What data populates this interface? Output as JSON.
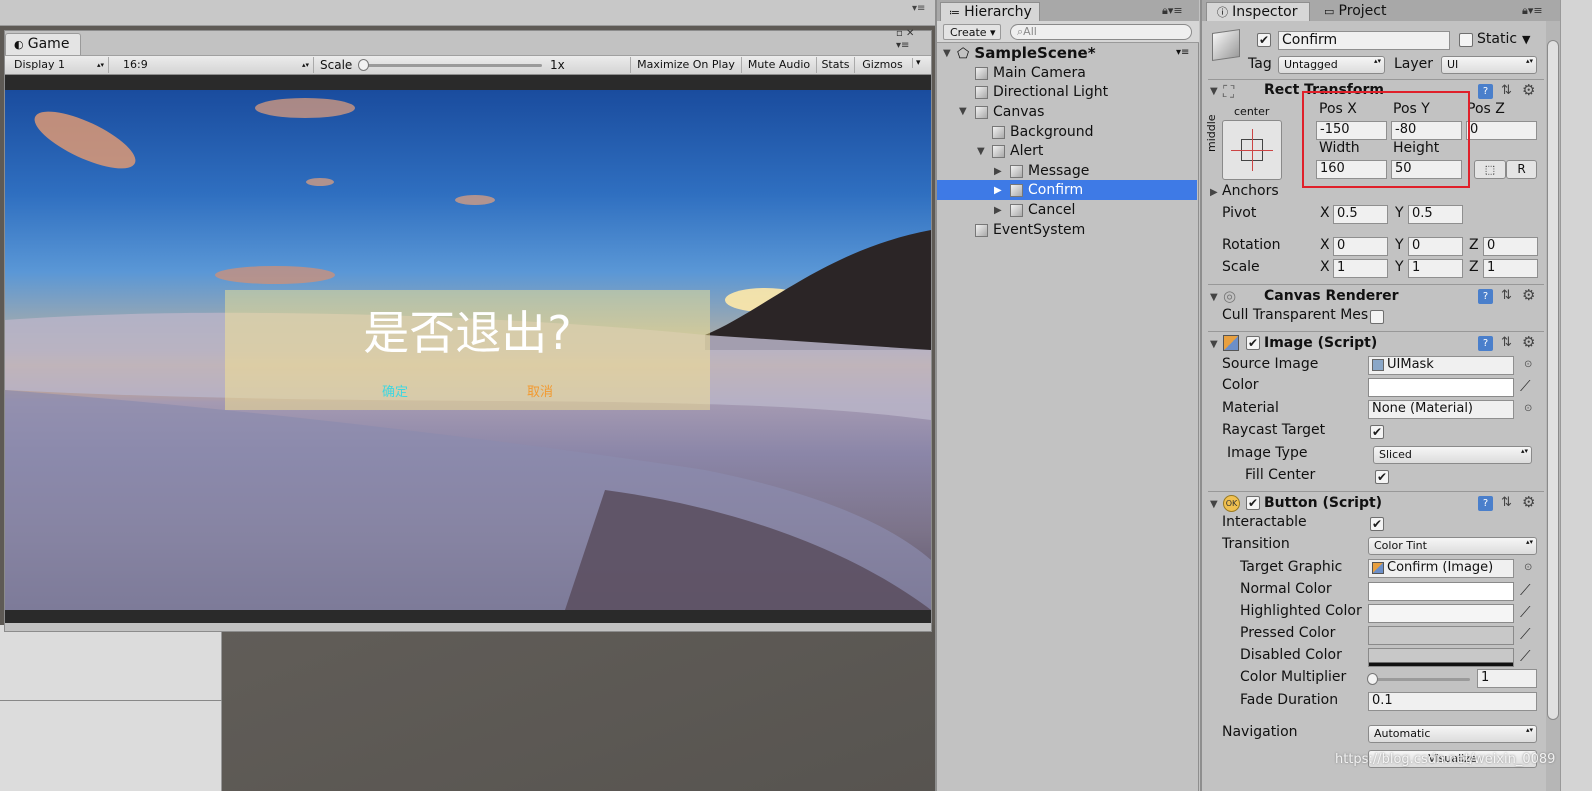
{
  "game": {
    "tab_label": "Game",
    "display": "Display 1",
    "aspect": "16:9",
    "scale_label": "Scale",
    "scale_value": "1x",
    "buttons": [
      "Maximize On Play",
      "Mute Audio",
      "Stats",
      "Gizmos"
    ],
    "alert_title": "是否退出?",
    "confirm_text": "确定",
    "cancel_text": "取消"
  },
  "hierarchy": {
    "tab_label": "Hierarchy",
    "create_label": "Create",
    "search_placeholder": "All",
    "scene": "SampleScene*",
    "items": [
      "Main Camera",
      "Directional Light",
      "Canvas",
      "Background",
      "Alert",
      "Message",
      "Confirm",
      "Cancel",
      "EventSystem"
    ]
  },
  "inspector": {
    "tab_label": "Inspector",
    "project_tab": "Project",
    "object_name": "Confirm",
    "static_label": "Static",
    "tag_label": "Tag",
    "tag_value": "Untagged",
    "layer_label": "Layer",
    "layer_value": "UI",
    "rect": {
      "title": "Rect Transform",
      "anchor_h": "center",
      "anchor_v": "middle",
      "pos_x_label": "Pos X",
      "pos_y_label": "Pos Y",
      "pos_z_label": "Pos Z",
      "pos_x": "-150",
      "pos_y": "-80",
      "pos_z": "0",
      "width_label": "Width",
      "height_label": "Height",
      "width": "160",
      "height": "50",
      "r_btn": "R",
      "anchors_label": "Anchors",
      "pivot_label": "Pivot",
      "pivot_x": "0.5",
      "pivot_y": "0.5",
      "rotation_label": "Rotation",
      "rot_x": "0",
      "rot_y": "0",
      "rot_z": "0",
      "scale_label": "Scale",
      "scale_x": "1",
      "scale_y": "1",
      "scale_z": "1",
      "x": "X",
      "y": "Y",
      "z": "Z"
    },
    "canvas_renderer": {
      "title": "Canvas Renderer",
      "cull_label": "Cull Transparent Mes"
    },
    "image": {
      "title": "Image (Script)",
      "source_label": "Source Image",
      "source_value": "UIMask",
      "color_label": "Color",
      "material_label": "Material",
      "material_value": "None (Material)",
      "raycast_label": "Raycast Target",
      "type_label": "Image Type",
      "type_value": "Sliced",
      "fill_label": "Fill Center"
    },
    "button": {
      "title": "Button (Script)",
      "interactable_label": "Interactable",
      "transition_label": "Transition",
      "transition_value": "Color Tint",
      "target_label": "Target Graphic",
      "target_value": "Confirm (Image)",
      "normal_label": "Normal Color",
      "highlighted_label": "Highlighted Color",
      "pressed_label": "Pressed Color",
      "disabled_label": "Disabled Color",
      "multiplier_label": "Color Multiplier",
      "multiplier_value": "1",
      "fade_label": "Fade Duration",
      "fade_value": "0.1",
      "navigation_label": "Navigation",
      "navigation_value": "Automatic",
      "visualize_label": "Visualize"
    }
  },
  "watermark": "https://blog.csdn.net/weixin_0089",
  "colors": {
    "selection": "#3e7ae6",
    "highlight_box": "#e0202a",
    "panel": "#c2c2c2"
  }
}
